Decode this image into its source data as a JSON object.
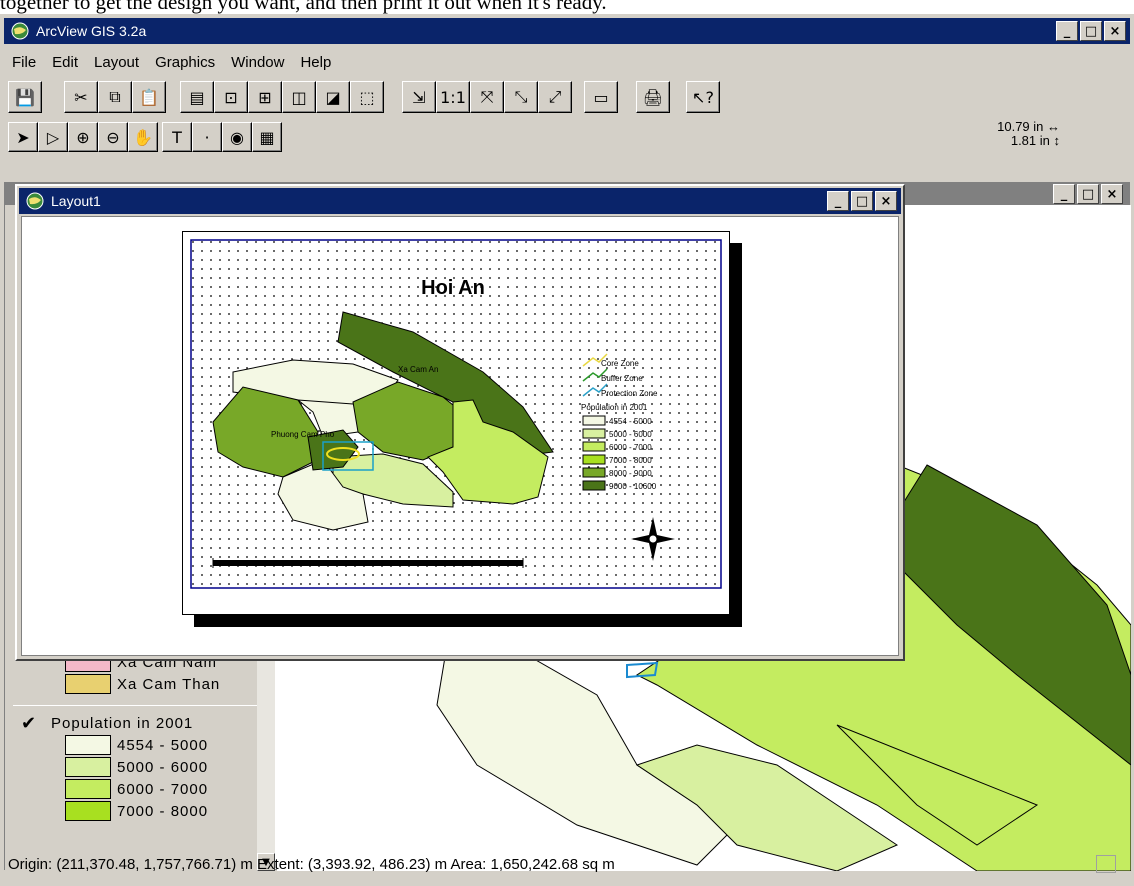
{
  "caption_text": "together to get the design you want, and then print it out when it's ready.",
  "app": {
    "title": "ArcView GIS 3.2a",
    "win_buttons": [
      "_",
      "□",
      "×"
    ]
  },
  "menu": [
    "File",
    "Edit",
    "Layout",
    "Graphics",
    "Window",
    "Help"
  ],
  "toolbar1": [
    {
      "icon": "save-icon",
      "glyph": "💾"
    },
    {
      "icon": "cut-icon",
      "glyph": "✂"
    },
    {
      "icon": "copy-icon",
      "glyph": "⧉"
    },
    {
      "icon": "paste-icon",
      "glyph": "📋"
    },
    {
      "icon": "properties-icon",
      "glyph": "▤"
    },
    {
      "icon": "group-icon",
      "glyph": "⊡"
    },
    {
      "icon": "ungroup-icon",
      "glyph": "⊞"
    },
    {
      "icon": "bring-front-icon",
      "glyph": "◫"
    },
    {
      "icon": "send-back-icon",
      "glyph": "◪"
    },
    {
      "icon": "align-icon",
      "glyph": "⬚"
    },
    {
      "icon": "zoom-full-icon",
      "glyph": "⇲"
    },
    {
      "icon": "zoom-actual-icon",
      "glyph": "1:1"
    },
    {
      "icon": "zoom-selected-icon",
      "glyph": "⤧"
    },
    {
      "icon": "zoom-in-icon",
      "glyph": "⤡"
    },
    {
      "icon": "zoom-out-icon",
      "glyph": "⤢"
    },
    {
      "icon": "page-setup-icon",
      "glyph": "▭"
    },
    {
      "icon": "print-icon",
      "glyph": "🖨"
    },
    {
      "icon": "help-icon",
      "glyph": "↖?"
    }
  ],
  "toolbar2": [
    {
      "icon": "pointer-icon",
      "glyph": "➤"
    },
    {
      "icon": "vertex-edit-icon",
      "glyph": "▷"
    },
    {
      "icon": "zoom-in-tool-icon",
      "glyph": "⊕"
    },
    {
      "icon": "zoom-out-tool-icon",
      "glyph": "⊖"
    },
    {
      "icon": "pan-icon",
      "glyph": "✋"
    },
    {
      "icon": "text-tool-icon",
      "glyph": "T"
    },
    {
      "icon": "point-tool-icon",
      "glyph": "·"
    },
    {
      "icon": "view-frame-icon",
      "glyph": "◉"
    },
    {
      "icon": "legend-frame-icon",
      "glyph": "▦"
    }
  ],
  "coords": {
    "x": "10.79 in ↔",
    "y": "1.81 in ↕"
  },
  "toc": {
    "layer1_items": [
      {
        "label": "Xa Cam Nam",
        "color": "#f4b8c8"
      },
      {
        "label": "Xa Cam Than",
        "color": "#e8d070"
      }
    ],
    "layer2_title": "Population in 2001",
    "layer2_items": [
      {
        "label": "4554 - 5000",
        "color": "#f4f8e4"
      },
      {
        "label": "5000 - 6000",
        "color": "#d8f0a0"
      },
      {
        "label": "6000 - 7000",
        "color": "#c4ec60"
      },
      {
        "label": "7000 - 8000",
        "color": "#a8e020"
      }
    ]
  },
  "layout_window": {
    "title": "Layout1"
  },
  "layout_page": {
    "map_title": "Hoi An",
    "labels": {
      "xa_cam_an": "Xa Cam An",
      "phuong": "Phuong Cam Pho"
    },
    "legend": {
      "zones": [
        "Core Zone",
        "Buffer Zone",
        "Protection Zone"
      ],
      "pop_title": "Population in 2001",
      "pop_items": [
        {
          "label": "4554 - 5000",
          "color": "#f4f8e4"
        },
        {
          "label": "5000 - 6000",
          "color": "#d8f0a0"
        },
        {
          "label": "6000 - 7000",
          "color": "#c4ec60"
        },
        {
          "label": "7000 - 8000",
          "color": "#a8e020"
        },
        {
          "label": "8000 - 9000",
          "color": "#78a828"
        },
        {
          "label": "9000 - 10600",
          "color": "#4a7418"
        }
      ]
    }
  },
  "status": "Origin: (211,370.48, 1,757,766.71) m  Extent: (3,393.92, 486.23) m  Area: 1,650,242.68 sq m"
}
